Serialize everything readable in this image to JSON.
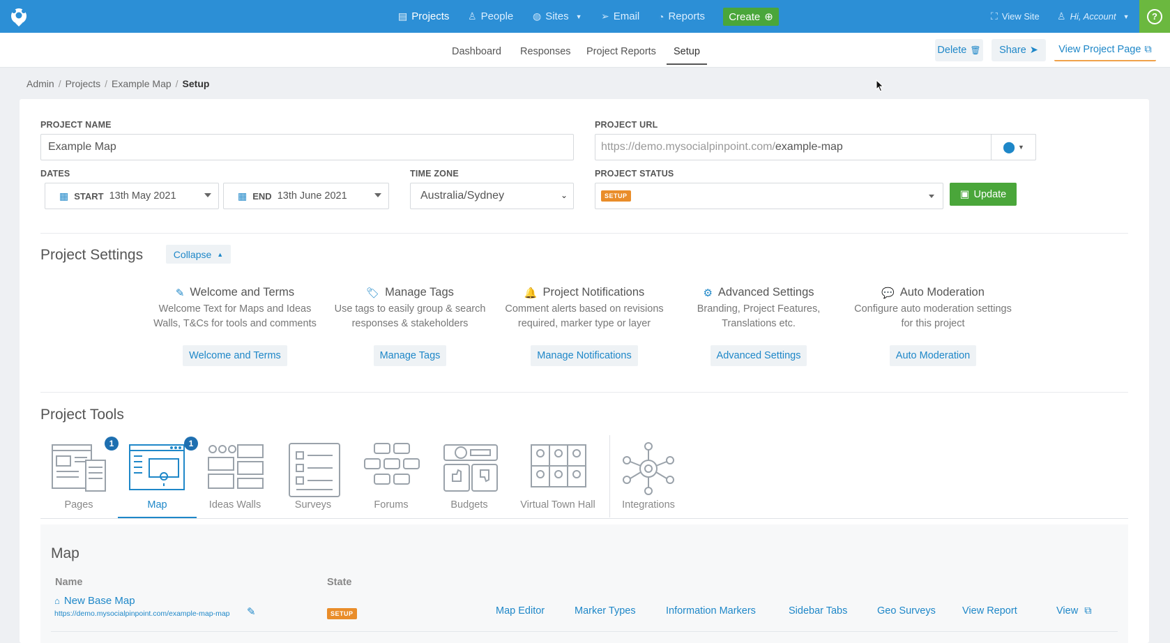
{
  "topnav": {
    "items": [
      {
        "label": "Projects",
        "icon": "chat-icon"
      },
      {
        "label": "People",
        "icon": "person-icon"
      },
      {
        "label": "Sites",
        "icon": "globe-icon"
      },
      {
        "label": "Email",
        "icon": "paper-plane-icon"
      },
      {
        "label": "Reports",
        "icon": "gauge-icon"
      }
    ],
    "create_label": "Create",
    "view_site": "View Site",
    "account": "Hi, Account",
    "help": "?"
  },
  "subnav": {
    "tabs": [
      "Dashboard",
      "Responses",
      "Project Reports",
      "Setup"
    ],
    "active": "Setup",
    "delete": "Delete",
    "share": "Share",
    "view_project": "View Project Page"
  },
  "breadcrumb": [
    "Admin",
    "Projects",
    "Example Map",
    "Setup"
  ],
  "form": {
    "project_name_label": "PROJECT NAME",
    "project_name": "Example Map",
    "project_url_label": "PROJECT URL",
    "url_prefix": "https://demo.mysocialpinpoint.com/",
    "url_slug": "example-map",
    "dates_label": "DATES",
    "start_label": "START",
    "start_date": "13th May 2021",
    "end_label": "END",
    "end_date": "13th June 2021",
    "timezone_label": "TIME ZONE",
    "timezone": "Australia/Sydney",
    "status_label": "PROJECT STATUS",
    "status": "SETUP",
    "update": "Update"
  },
  "settings": {
    "title": "Project Settings",
    "collapse": "Collapse",
    "items": [
      {
        "title": "Welcome and Terms",
        "desc1": "Welcome Text for Maps and Ideas",
        "desc2": "Walls, T&Cs for tools and comments",
        "button": "Welcome and Terms",
        "icon": "pencil-icon"
      },
      {
        "title": "Manage Tags",
        "desc1": "Use tags to easily group & search",
        "desc2": "responses & stakeholders",
        "button": "Manage Tags",
        "icon": "tag-icon"
      },
      {
        "title": "Project Notifications",
        "desc1": "Comment alerts based on revisions",
        "desc2": "required, marker type or layer",
        "button": "Manage Notifications",
        "icon": "bell-icon"
      },
      {
        "title": "Advanced Settings",
        "desc1": "Branding, Project Features,",
        "desc2": "Translations etc.",
        "button": "Advanced Settings",
        "icon": "gear-icon"
      },
      {
        "title": "Auto Moderation",
        "desc1": "Configure auto moderation settings",
        "desc2": "for this project",
        "button": "Auto Moderation",
        "icon": "comment-icon"
      }
    ]
  },
  "tools": {
    "title": "Project Tools",
    "items": [
      {
        "label": "Pages",
        "badge": "1"
      },
      {
        "label": "Map",
        "badge": "1"
      },
      {
        "label": "Ideas Walls"
      },
      {
        "label": "Surveys"
      },
      {
        "label": "Forums"
      },
      {
        "label": "Budgets"
      },
      {
        "label": "Virtual Town Hall"
      },
      {
        "label": "Integrations"
      }
    ],
    "active": "Map"
  },
  "map": {
    "title": "Map",
    "col_name": "Name",
    "col_state": "State",
    "row": {
      "name": "New Base Map",
      "url": "https://demo.mysocialpinpoint.com/example-map-map",
      "state": "SETUP",
      "links": [
        "Map Editor",
        "Marker Types",
        "Information Markers",
        "Sidebar Tabs",
        "Geo Surveys",
        "View Report",
        "View"
      ]
    }
  }
}
